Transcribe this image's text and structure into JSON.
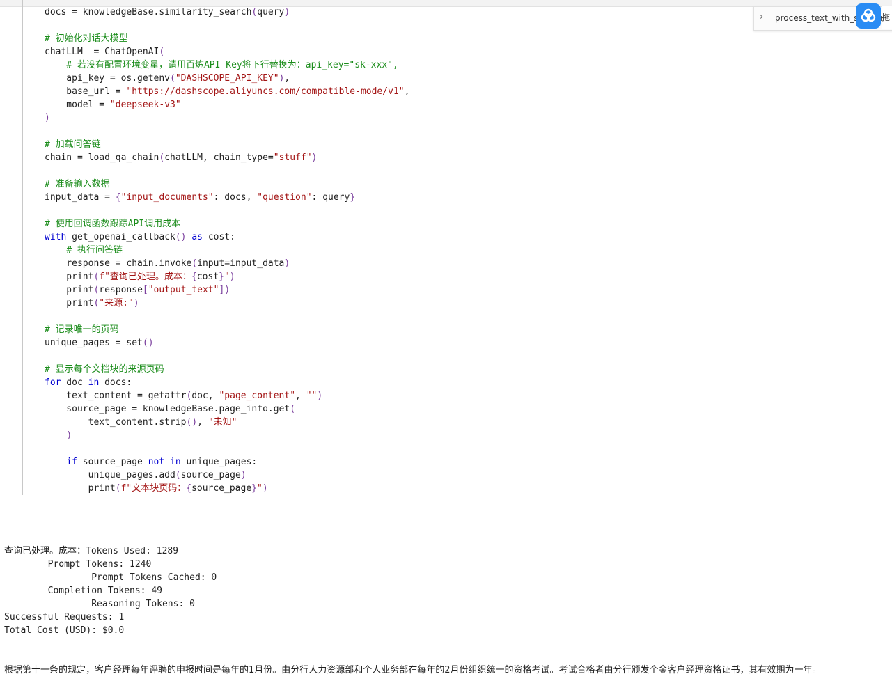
{
  "code_lines": [
    [
      {
        "t": "docs = knowledgeBase.similarity_search",
        "c": ""
      },
      {
        "t": "(",
        "c": "br"
      },
      {
        "t": "query",
        "c": ""
      },
      {
        "t": ")",
        "c": "br"
      }
    ],
    [],
    [
      {
        "t": "# 初始化对话大模型",
        "c": "cm"
      }
    ],
    [
      {
        "t": "chatLLM  = ChatOpenAI",
        "c": ""
      },
      {
        "t": "(",
        "c": "br"
      }
    ],
    [
      {
        "t": "    ",
        "c": ""
      },
      {
        "t": "# 若没有配置环境变量，请用百炼API Key将下行替换为：api_key=\"sk-xxx\",",
        "c": "cm"
      }
    ],
    [
      {
        "t": "    api_key = os.getenv",
        "c": ""
      },
      {
        "t": "(",
        "c": "br"
      },
      {
        "t": "\"DASHSCOPE_API_KEY\"",
        "c": "str"
      },
      {
        "t": ")",
        "c": "br"
      },
      {
        "t": ",",
        "c": ""
      }
    ],
    [
      {
        "t": "    base_url = ",
        "c": ""
      },
      {
        "t": "\"",
        "c": "str"
      },
      {
        "t": "https://dashscope.aliyuncs.com/compatible-mode/v1",
        "c": "url"
      },
      {
        "t": "\"",
        "c": "str"
      },
      {
        "t": ",",
        "c": ""
      }
    ],
    [
      {
        "t": "    model = ",
        "c": ""
      },
      {
        "t": "\"deepseek-v3\"",
        "c": "str"
      }
    ],
    [
      {
        "t": ")",
        "c": "br"
      }
    ],
    [],
    [
      {
        "t": "# 加载问答链",
        "c": "cm"
      }
    ],
    [
      {
        "t": "chain = load_qa_chain",
        "c": ""
      },
      {
        "t": "(",
        "c": "br"
      },
      {
        "t": "chatLLM, chain_type=",
        "c": ""
      },
      {
        "t": "\"stuff\"",
        "c": "str"
      },
      {
        "t": ")",
        "c": "br"
      }
    ],
    [],
    [
      {
        "t": "# 准备输入数据",
        "c": "cm"
      }
    ],
    [
      {
        "t": "input_data = ",
        "c": ""
      },
      {
        "t": "{",
        "c": "br"
      },
      {
        "t": "\"input_documents\"",
        "c": "str"
      },
      {
        "t": ": docs, ",
        "c": ""
      },
      {
        "t": "\"question\"",
        "c": "str"
      },
      {
        "t": ": query",
        "c": ""
      },
      {
        "t": "}",
        "c": "br"
      }
    ],
    [],
    [
      {
        "t": "# 使用回调函数跟踪API调用成本",
        "c": "cm"
      }
    ],
    [
      {
        "t": "with",
        "c": "kw"
      },
      {
        "t": " get_openai_callback",
        "c": ""
      },
      {
        "t": "()",
        "c": "br"
      },
      {
        "t": " ",
        "c": ""
      },
      {
        "t": "as",
        "c": "kw"
      },
      {
        "t": " cost:",
        "c": ""
      }
    ],
    [
      {
        "t": "    ",
        "c": ""
      },
      {
        "t": "# 执行问答链",
        "c": "cm"
      }
    ],
    [
      {
        "t": "    response = chain.invoke",
        "c": ""
      },
      {
        "t": "(",
        "c": "br"
      },
      {
        "t": "input=input_data",
        "c": ""
      },
      {
        "t": ")",
        "c": "br"
      }
    ],
    [
      {
        "t": "    print",
        "c": ""
      },
      {
        "t": "(",
        "c": "br"
      },
      {
        "t": "f\"查询已处理。成本：",
        "c": "str"
      },
      {
        "t": "{",
        "c": "br"
      },
      {
        "t": "cost",
        "c": ""
      },
      {
        "t": "}",
        "c": "br"
      },
      {
        "t": "\"",
        "c": "str"
      },
      {
        "t": ")",
        "c": "br"
      }
    ],
    [
      {
        "t": "    print",
        "c": ""
      },
      {
        "t": "(",
        "c": "br"
      },
      {
        "t": "response",
        "c": ""
      },
      {
        "t": "[",
        "c": "br"
      },
      {
        "t": "\"output_text\"",
        "c": "str"
      },
      {
        "t": "]",
        "c": "br"
      },
      {
        "t": ")",
        "c": "br"
      }
    ],
    [
      {
        "t": "    print",
        "c": ""
      },
      {
        "t": "(",
        "c": "br"
      },
      {
        "t": "\"来源:\"",
        "c": "str"
      },
      {
        "t": ")",
        "c": "br"
      }
    ],
    [],
    [
      {
        "t": "# 记录唯一的页码",
        "c": "cm"
      }
    ],
    [
      {
        "t": "unique_pages = set",
        "c": ""
      },
      {
        "t": "()",
        "c": "br"
      }
    ],
    [],
    [
      {
        "t": "# 显示每个文档块的来源页码",
        "c": "cm"
      }
    ],
    [
      {
        "t": "for",
        "c": "kw"
      },
      {
        "t": " doc ",
        "c": ""
      },
      {
        "t": "in",
        "c": "kw"
      },
      {
        "t": " docs:",
        "c": ""
      }
    ],
    [
      {
        "t": "    text_content = getattr",
        "c": ""
      },
      {
        "t": "(",
        "c": "br"
      },
      {
        "t": "doc, ",
        "c": ""
      },
      {
        "t": "\"page_content\"",
        "c": "str"
      },
      {
        "t": ", ",
        "c": ""
      },
      {
        "t": "\"\"",
        "c": "str"
      },
      {
        "t": ")",
        "c": "br"
      }
    ],
    [
      {
        "t": "    source_page = knowledgeBase.page_info.get",
        "c": ""
      },
      {
        "t": "(",
        "c": "br"
      }
    ],
    [
      {
        "t": "        text_content.strip",
        "c": ""
      },
      {
        "t": "()",
        "c": "br"
      },
      {
        "t": ", ",
        "c": ""
      },
      {
        "t": "\"未知\"",
        "c": "str"
      }
    ],
    [
      {
        "t": "    ",
        "c": ""
      },
      {
        "t": ")",
        "c": "br"
      }
    ],
    [],
    [
      {
        "t": "    ",
        "c": ""
      },
      {
        "t": "if",
        "c": "kw"
      },
      {
        "t": " source_page ",
        "c": ""
      },
      {
        "t": "not",
        "c": "kw"
      },
      {
        "t": " ",
        "c": ""
      },
      {
        "t": "in",
        "c": "kw"
      },
      {
        "t": " unique_pages:",
        "c": ""
      }
    ],
    [
      {
        "t": "        unique_pages.add",
        "c": ""
      },
      {
        "t": "(",
        "c": "br"
      },
      {
        "t": "source_page",
        "c": ""
      },
      {
        "t": ")",
        "c": "br"
      }
    ],
    [
      {
        "t": "        print",
        "c": ""
      },
      {
        "t": "(",
        "c": "br"
      },
      {
        "t": "f\"文本块页码：",
        "c": "str"
      },
      {
        "t": "{",
        "c": "br"
      },
      {
        "t": "source_page",
        "c": ""
      },
      {
        "t": "}",
        "c": "br"
      },
      {
        "t": "\"",
        "c": "str"
      },
      {
        "t": ")",
        "c": "br"
      }
    ]
  ],
  "output_lines": [
    "查询已处理。成本：Tokens Used: 1289",
    "\tPrompt Tokens: 1240",
    "\t\tPrompt Tokens Cached: 0",
    "\tCompletion Tokens: 49",
    "\t\tReasoning Tokens: 0",
    "Successful Requests: 1",
    "Total Cost (USD): $0.0"
  ],
  "answer_text": "根据第十一条的规定，客户经理每年评聘的申报时间是每年的1月份。由分行人力资源部和个人业务部在每年的2月份组织统一的资格考试。考试合格者由分行颁发个金客户经理资格证书，其有效期为一年。",
  "outline": {
    "label": "process_text_with_splitter"
  },
  "extension": {
    "tab_label": "拖"
  }
}
